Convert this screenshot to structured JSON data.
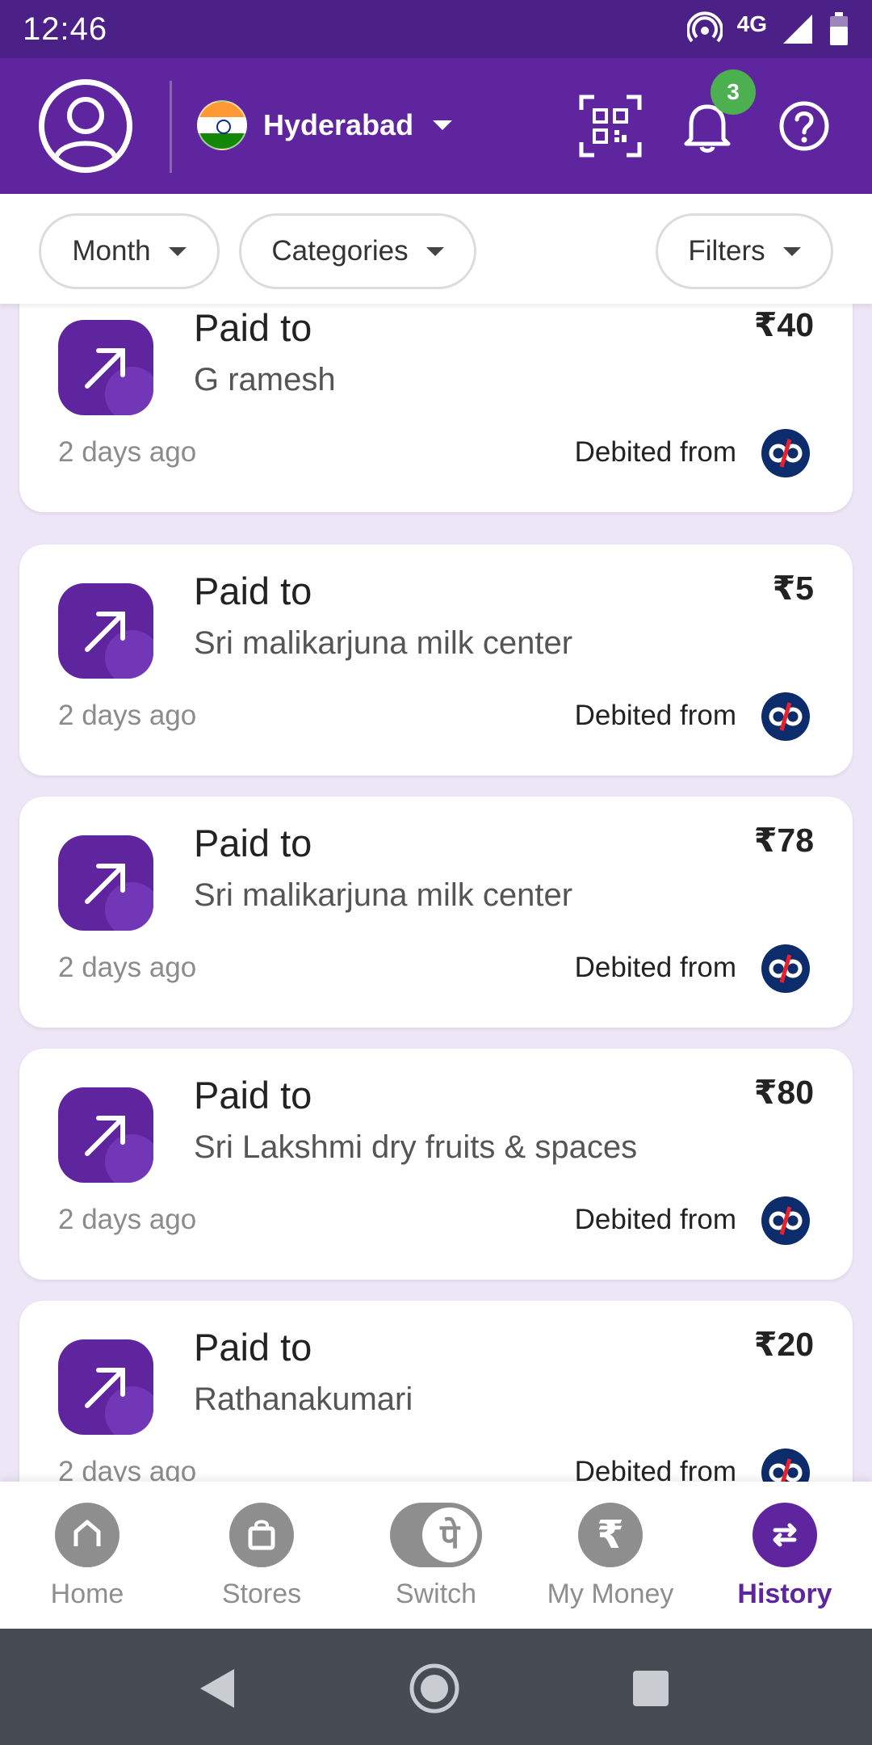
{
  "status_bar": {
    "time": "12:46",
    "network": "4G"
  },
  "header": {
    "city": "Hyderabad",
    "notification_count": "3"
  },
  "filters": [
    {
      "label": "Month"
    },
    {
      "label": "Categories"
    },
    {
      "label": "Filters"
    }
  ],
  "transactions": [
    {
      "title": "Paid to",
      "payee": "G ramesh",
      "amount": "₹40",
      "time": "2 days ago",
      "source_label": "Debited from"
    },
    {
      "title": "Paid to",
      "payee": "Sri malikarjuna milk center",
      "amount": "₹5",
      "time": "2 days ago",
      "source_label": "Debited from"
    },
    {
      "title": "Paid to",
      "payee": "Sri malikarjuna milk center",
      "amount": "₹78",
      "time": "2 days ago",
      "source_label": "Debited from"
    },
    {
      "title": "Paid to",
      "payee": "Sri Lakshmi dry fruits & spaces",
      "amount": "₹80",
      "time": "2 days ago",
      "source_label": "Debited from"
    },
    {
      "title": "Paid to",
      "payee": "Rathanakumari",
      "amount": "₹20",
      "time": "2 days ago",
      "source_label": "Debited from"
    }
  ],
  "bottom_nav": [
    {
      "label": "Home",
      "icon": "home-icon"
    },
    {
      "label": "Stores",
      "icon": "bag-icon"
    },
    {
      "label": "Switch",
      "icon": "switch-icon",
      "glyph": "पे"
    },
    {
      "label": "My Money",
      "icon": "rupee-icon",
      "glyph": "₹"
    },
    {
      "label": "History",
      "icon": "history-icon",
      "active": true
    }
  ],
  "colors": {
    "brand": "#5f259f",
    "status_bar": "#4b2188",
    "badge": "#4caf50",
    "list_bg": "#ede6f7"
  }
}
